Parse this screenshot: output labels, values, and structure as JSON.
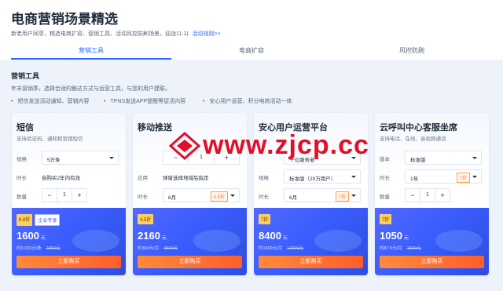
{
  "page": {
    "title": "电商营销场景精选",
    "subtitle": "新老用户同享，精选电商扩容、营销工具、活动风控防刷场景，迎战11.11",
    "rules_link": "活动规则>>"
  },
  "tabs": [
    {
      "label": "营销工具",
      "active": true
    },
    {
      "label": "电商扩容",
      "active": false
    },
    {
      "label": "风控防刷",
      "active": false
    }
  ],
  "section": {
    "title": "营销工具",
    "desc": "年末营销季，选择合适的触达方式与运营工具，与您的用户建联。",
    "bullets": [
      "短信发送活动通知、营销内容",
      "TPNS发送APP提醒等促活内容",
      "安心用户运营、积分电商活动一体"
    ]
  },
  "cards": [
    {
      "name": "短信",
      "desc": "支持验证码、通知和营销短信",
      "rows": [
        {
          "label": "规格",
          "type": "select",
          "value": "5万条"
        },
        {
          "label": "时长",
          "type": "text",
          "value": "自购买2年内有效"
        },
        {
          "label": "数量",
          "type": "stepper",
          "value": "1"
        }
      ],
      "badges": [
        {
          "text": "6.8折",
          "style": "y"
        },
        {
          "text": "企业专享",
          "style": "o"
        }
      ],
      "price": "1600",
      "unit": "元",
      "per": "约0.032元/条",
      "orig": "2350元",
      "buy": "立即购买"
    },
    {
      "name": "移动推送",
      "desc": "",
      "rows": [
        {
          "label": "",
          "type": "stepper",
          "value": "1"
        },
        {
          "label": "应用",
          "type": "text",
          "value": "弹窗选择地域后指定"
        },
        {
          "label": "时长",
          "type": "select",
          "value": "6月",
          "disc": "4.5折"
        }
      ],
      "badges": [
        {
          "text": "4.5折",
          "style": "y"
        }
      ],
      "price": "2160",
      "unit": "元",
      "per": "约360元/月",
      "orig": "4800元",
      "buy": "立即购买"
    },
    {
      "name": "安心用户运营平台",
      "desc": "",
      "rows": [
        {
          "label": "",
          "type": "select",
          "value": "千位服务者"
        },
        {
          "label": "规格",
          "type": "select",
          "value": "标准版（20万用户）"
        },
        {
          "label": "时长",
          "type": "select",
          "value": "6月",
          "disc": "7折"
        }
      ],
      "badges": [
        {
          "text": "7折",
          "style": "y"
        }
      ],
      "price": "8400",
      "unit": "元",
      "per": "约1400元/月",
      "orig": "12000元",
      "buy": "立即购买"
    },
    {
      "name": "云呼叫中心客服坐席",
      "desc": "支持电话、在线、音视频通话",
      "rows": [
        {
          "label": "版本",
          "type": "select",
          "value": "标准版"
        },
        {
          "label": "时长",
          "type": "select",
          "value": "1年",
          "disc": "7折"
        },
        {
          "label": "数量",
          "type": "stepper",
          "value": "1"
        }
      ],
      "badges": [
        {
          "text": "7折",
          "style": "y"
        }
      ],
      "price": "1050",
      "unit": "元",
      "per": "约87.5元/月",
      "orig": "1500元",
      "buy": "立即购买"
    }
  ],
  "watermark": "www.zjcp.cc",
  "colors": {
    "accent": "#2f6bff",
    "price_bg": "#3b5dff",
    "buy": "#ff6a2c",
    "watermark": "#e0102b"
  }
}
